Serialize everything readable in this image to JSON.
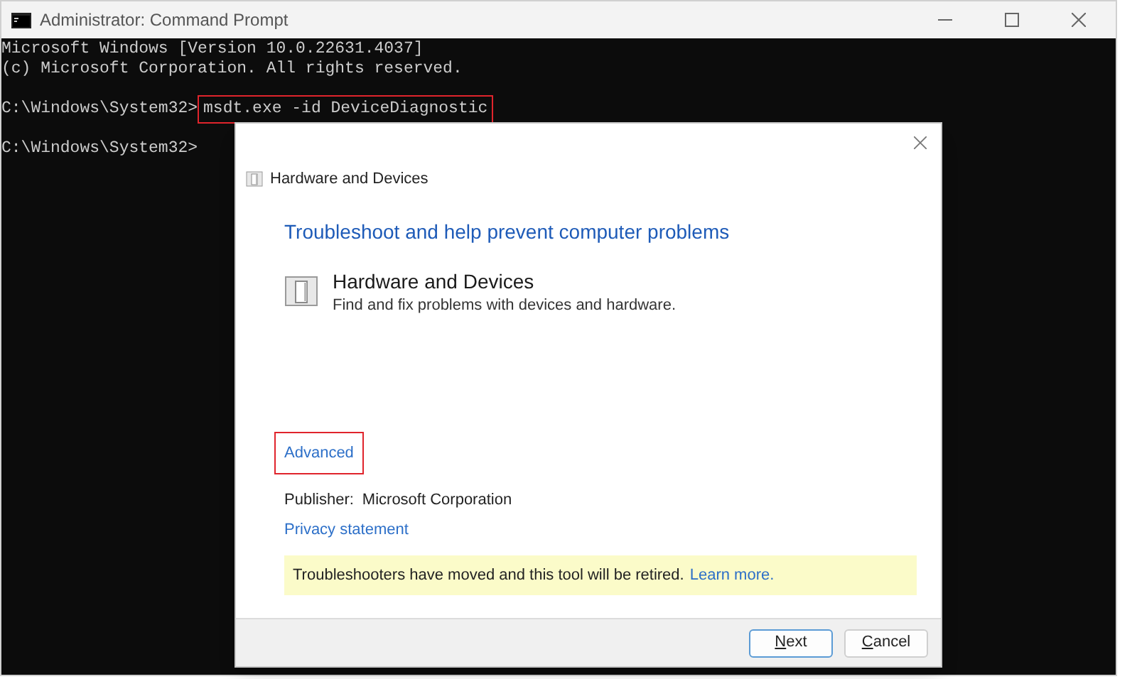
{
  "window": {
    "title": "Administrator: Command Prompt"
  },
  "console": {
    "lines": [
      {
        "kind": "text",
        "text": "Microsoft Windows [Version 10.0.22631.4037]"
      },
      {
        "kind": "text",
        "text": "(c) Microsoft Corporation. All rights reserved."
      },
      {
        "kind": "blank"
      },
      {
        "kind": "prompt",
        "prompt": "C:\\Windows\\System32>",
        "command": "msdt.exe -id DeviceDiagnostic",
        "highlighted": true
      },
      {
        "kind": "blank"
      },
      {
        "kind": "prompt",
        "prompt": "C:\\Windows\\System32>"
      }
    ]
  },
  "dialog": {
    "title": "Hardware and Devices",
    "heading": "Troubleshoot and help prevent computer problems",
    "troubleshooter": {
      "name": "Hardware and Devices",
      "description": "Find and fix problems with devices and hardware."
    },
    "advanced": {
      "label": "Advanced",
      "highlighted": true
    },
    "publisher_label": "Publisher:",
    "publisher": "Microsoft Corporation",
    "privacy_link": "Privacy statement",
    "notice": {
      "text": "Troubleshooters have moved and this tool will be retired.",
      "link": "Learn more."
    },
    "buttons": [
      {
        "label": "Next",
        "kind": "default"
      },
      {
        "label": "Cancel",
        "kind": "normal"
      }
    ]
  }
}
